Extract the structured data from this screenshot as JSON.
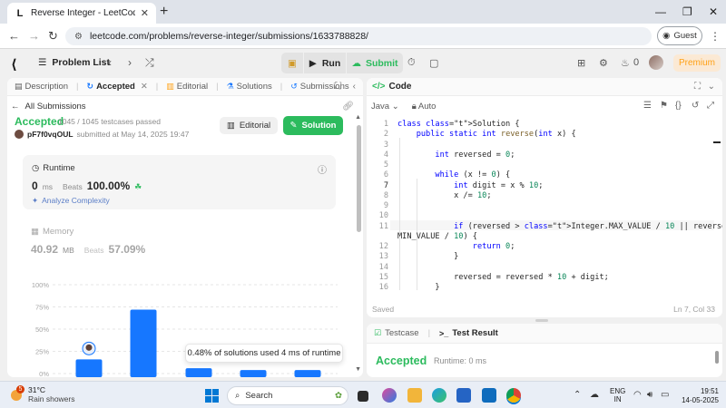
{
  "browser": {
    "tab_title": "Reverse Integer - LeetCode",
    "url": "leetcode.com/problems/reverse-integer/submissions/1633788828/",
    "guest_label": "Guest"
  },
  "navbar": {
    "problem_list": "Problem List",
    "run": "Run",
    "submit": "Submit",
    "coins": "0",
    "premium": "Premium"
  },
  "left_tabs": {
    "description": "Description",
    "accepted": "Accepted",
    "editorial": "Editorial",
    "solutions": "Solutions",
    "submissions": "Submissions"
  },
  "submission": {
    "back": "All Submissions",
    "status": "Accepted",
    "passed": "1045 / 1045 testcases passed",
    "user": "pF7f0vqOUL",
    "submitted_on": "submitted at May 14, 2025 19:47",
    "editorial_btn": "Editorial",
    "solution_btn": "Solution",
    "runtime_label": "Runtime",
    "runtime_value": "0",
    "runtime_unit": "ms",
    "beats_label": "Beats",
    "runtime_beats": "100.00%",
    "analyze": "Analyze Complexity",
    "memory_label": "Memory",
    "memory_value": "40.92",
    "memory_unit": "MB",
    "memory_beats": "57.09%",
    "tooltip": "0.48% of solutions used 4 ms of runtime"
  },
  "chart_data": {
    "type": "bar",
    "ytick_labels": [
      "100%",
      "75%",
      "50%",
      "25%",
      "0%"
    ],
    "ylim": [
      0,
      100
    ],
    "values": [
      16,
      72,
      6,
      4,
      4
    ],
    "highlighted_index": 0,
    "color": "#1677ff"
  },
  "code_panel": {
    "title": "Code",
    "language": "Java",
    "mode": "Auto",
    "status": "Saved",
    "cursor": "Ln 7, Col 33"
  },
  "code_lines": [
    {
      "n": "1",
      "text": "class Solution {"
    },
    {
      "n": "2",
      "text": "    public static int reverse(int x) {"
    },
    {
      "n": "3",
      "text": ""
    },
    {
      "n": "4",
      "text": "        int reversed = 0;"
    },
    {
      "n": "5",
      "text": ""
    },
    {
      "n": "6",
      "text": "        while (x != 0) {"
    },
    {
      "n": "7",
      "text": "            int digit = x % 10;"
    },
    {
      "n": "8",
      "text": "            x /= 10;"
    },
    {
      "n": "9",
      "text": ""
    },
    {
      "n": "10",
      "text": ""
    },
    {
      "n": "11",
      "text": "            if (reversed > Integer.MAX_VALUE / 10 || reversed < Integer."
    },
    {
      "n": "",
      "text": "MIN_VALUE / 10) {"
    },
    {
      "n": "12",
      "text": "                return 0;"
    },
    {
      "n": "13",
      "text": "            }"
    },
    {
      "n": "14",
      "text": ""
    },
    {
      "n": "15",
      "text": "            reversed = reversed * 10 + digit;"
    },
    {
      "n": "16",
      "text": "        }"
    }
  ],
  "result_panel": {
    "testcase": "Testcase",
    "test_result": "Test Result",
    "status": "Accepted",
    "runtime": "Runtime: 0 ms"
  },
  "taskbar": {
    "weather_badge": "5",
    "temperature": "31°C",
    "weather": "Rain showers",
    "search": "Search",
    "lang1": "ENG",
    "lang2": "IN",
    "time": "19:51",
    "date": "14-05-2025"
  }
}
